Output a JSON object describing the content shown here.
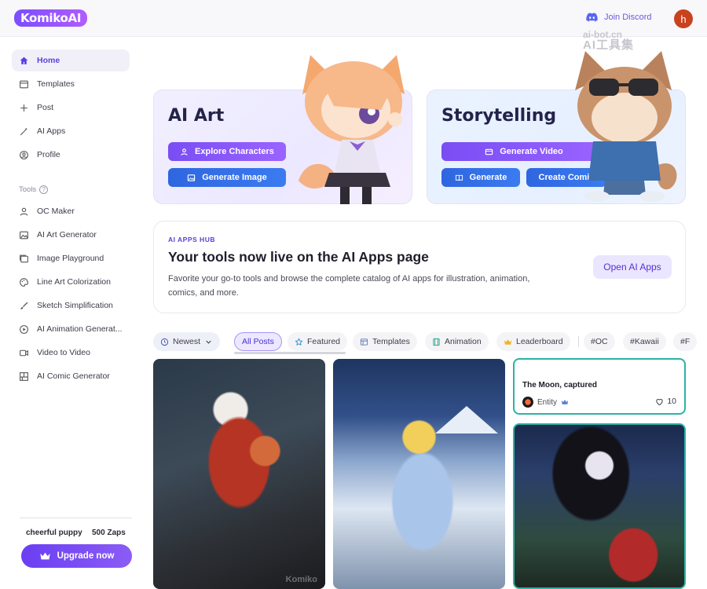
{
  "header": {
    "logo_text": "KomikoAI",
    "discord_label": "Join Discord",
    "avatar_initial": "h",
    "watermark_line1": "ai-bot.cn",
    "watermark_line2": "AI工具集"
  },
  "sidebar": {
    "nav": [
      {
        "label": "Home",
        "icon": "home-icon",
        "active": true
      },
      {
        "label": "Templates",
        "icon": "templates-icon"
      },
      {
        "label": "Post",
        "icon": "plus-icon"
      },
      {
        "label": "AI Apps",
        "icon": "magic-wand-icon"
      },
      {
        "label": "Profile",
        "icon": "user-circle-icon"
      }
    ],
    "tools_label": "Tools",
    "tools": [
      {
        "label": "OC Maker",
        "icon": "user-icon"
      },
      {
        "label": "AI Art Generator",
        "icon": "image-icon"
      },
      {
        "label": "Image Playground",
        "icon": "image-stack-icon"
      },
      {
        "label": "Line Art Colorization",
        "icon": "palette-icon"
      },
      {
        "label": "Sketch Simplification",
        "icon": "brush-icon"
      },
      {
        "label": "AI Animation Generat...",
        "icon": "play-circle-icon"
      },
      {
        "label": "Video to Video",
        "icon": "video-icon"
      },
      {
        "label": "AI Comic Generator",
        "icon": "comic-grid-icon"
      }
    ],
    "user_name": "cheerful puppy",
    "zaps": "500 Zaps",
    "upgrade_label": "Upgrade now"
  },
  "cards": {
    "art": {
      "title": "AI Art",
      "btn_explore": "Explore Characters",
      "btn_generate": "Generate Image"
    },
    "story": {
      "title": "Storytelling",
      "btn_video": "Generate Video",
      "btn_generate": "Generate",
      "btn_comic": "Create Comic"
    }
  },
  "hub": {
    "kicker": "AI APPS HUB",
    "title": "Your tools now live on the AI Apps page",
    "description": "Favorite your go-to tools and browse the complete catalog of AI apps for illustration, animation, comics, and more.",
    "button": "Open AI Apps"
  },
  "filters": {
    "sort": "Newest",
    "chips": [
      "All Posts",
      "Featured",
      "Templates",
      "Animation",
      "Leaderboard",
      "#OC",
      "#Kawaii",
      "#F"
    ]
  },
  "feed": {
    "text_post_title": "The Moon, captured",
    "text_post_author": "Entity",
    "text_post_likes": "10",
    "image_watermark": "Komiko"
  },
  "colors": {
    "accent": "#6a3ff2",
    "blue_button": "#2f66e0",
    "teal_border": "#2bb3a6"
  }
}
